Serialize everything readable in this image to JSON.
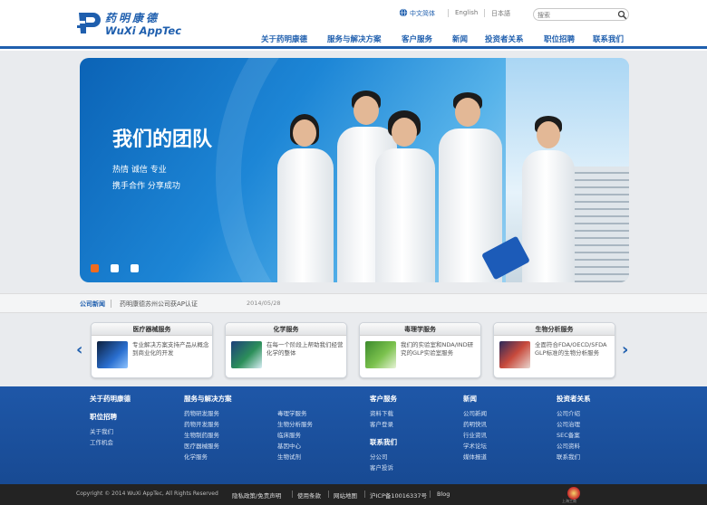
{
  "logo": {
    "cn": "药明康德",
    "en": "WuXi AppTec"
  },
  "lang": {
    "chinese": "中文简体",
    "english": "English",
    "japanese": "日本語"
  },
  "search": {
    "placeholder": "搜索"
  },
  "nav": [
    "关于药明康德",
    "服务与解决方案",
    "客户服务",
    "新闻",
    "投资者关系",
    "职位招聘",
    "联系我们"
  ],
  "banner": {
    "title": "我们的团队",
    "line1": "热情  诚信  专业",
    "line2": "携手合作  分享成功",
    "active_slide": 1
  },
  "news": {
    "label": "公司新闻",
    "text": "药明康德苏州公司获AP认证",
    "date": "2014/05/28"
  },
  "cards": [
    {
      "title": "医疗器械服务",
      "text": "专业解决方案支持产品从概念到商业化的开发",
      "accent": "#2a6fd0"
    },
    {
      "title": "化学服务",
      "text": "在每一个阶段上帮助我们经营化学的整体",
      "accent": "#2c8f5a"
    },
    {
      "title": "毒理学服务",
      "text": "我们的实验室和NDA/IND研究的GLP实验室服务",
      "accent": "#7cc24e"
    },
    {
      "title": "生物分析服务",
      "text": "全面符合FDA/OECD/SFDA GLP标准的生物分析服务",
      "accent": "#c84a3c"
    }
  ],
  "footer": {
    "col1": {
      "head": "关于药明康德",
      "head2": "职位招聘",
      "links": [
        "关于我们",
        "工作机会"
      ]
    },
    "col2": {
      "head": "服务与解决方案",
      "links_a": [
        "药物研发服务",
        "药物开发服务",
        "生物制药服务",
        "医疗器械服务",
        "化学服务"
      ],
      "links_b": [
        "毒理学服务",
        "生物分析服务",
        "临床服务",
        "基因中心",
        "生物试剂"
      ]
    },
    "col3": {
      "head": "客户服务",
      "links": [
        "资料下载",
        "客户登录"
      ],
      "head2": "联系我们",
      "links2": [
        "分公司",
        "客户投诉"
      ]
    },
    "col4": {
      "head": "新闻",
      "links": [
        "公司新闻",
        "药明快讯",
        "行业资讯",
        "学术论坛",
        "媒体报道"
      ]
    },
    "col5": {
      "head": "投资者关系",
      "links": [
        "公司介绍",
        "公司治理",
        "SEC备案",
        "公司资料",
        "联系我们"
      ]
    }
  },
  "copyright": {
    "text": "Copyright © 2014 WuXi AppTec, All Rights Reserved",
    "links": [
      "隐私政策/免责声明",
      "使用条款",
      "网站地图",
      "沪ICP备10016337号",
      "Blog"
    ],
    "badge": "上海工商"
  },
  "colors": {
    "brand": "#1f5fae",
    "accent": "#ef6b1f"
  }
}
